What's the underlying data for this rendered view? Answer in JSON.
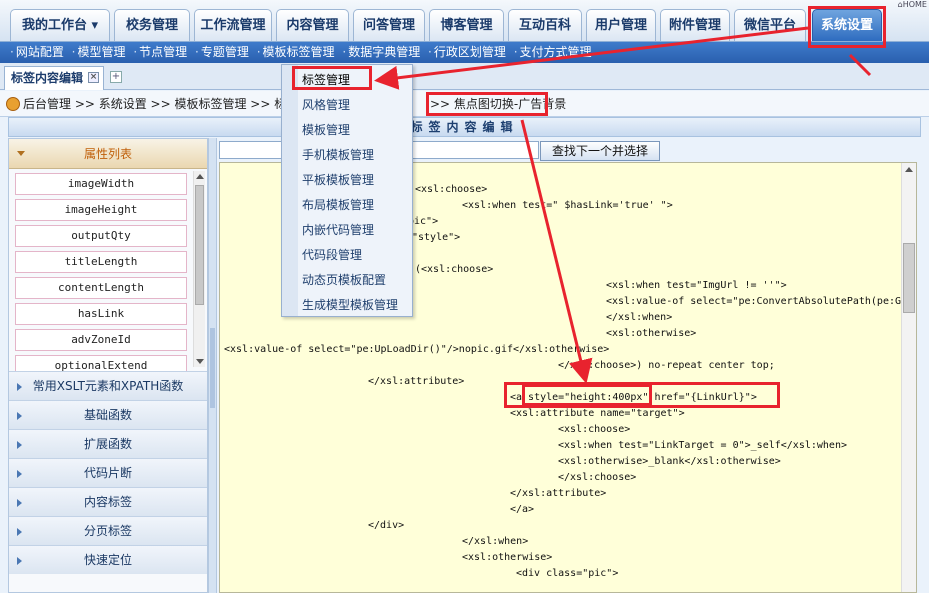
{
  "top_tabs": [
    {
      "label": "我的工作台 ▾"
    },
    {
      "label": "校务管理"
    },
    {
      "label": "工作流管理"
    },
    {
      "label": "内容管理"
    },
    {
      "label": "问答管理"
    },
    {
      "label": "博客管理"
    },
    {
      "label": "互动百科"
    },
    {
      "label": "用户管理"
    },
    {
      "label": "附件管理"
    },
    {
      "label": "微信平台"
    },
    {
      "label": "系统设置"
    }
  ],
  "home_link": "HOME",
  "sub_menu": [
    "网站配置",
    "模型管理",
    "节点管理",
    "专题管理",
    "模板标签管理",
    "数据字典管理",
    "行政区划管理",
    "支付方式管理"
  ],
  "doc_tab": {
    "label": "标签内容编辑",
    "close": "×",
    "add": "+"
  },
  "breadcrumb": {
    "path": "后台管理 >> 系统设置 >> 模板标签管理 >> 标签",
    "last": ">> 焦点图切换-广告背景"
  },
  "content_header": "标签内容编辑",
  "left_panel": {
    "attr_header": "属性列表",
    "attributes": [
      "imageWidth",
      "imageHeight",
      "outputQty",
      "titleLength",
      "contentLength",
      "hasLink",
      "advZoneId",
      "optionalExtend"
    ],
    "sections": [
      "常用XSLT元素和XPATH函数",
      "基础函数",
      "扩展函数",
      "代码片断",
      "内容标签",
      "分页标签",
      "快速定位"
    ]
  },
  "search": {
    "button_label": "查找下一个并选择"
  },
  "dropdown_menu": [
    "标签管理",
    "风格管理",
    "模板管理",
    "手机模板管理",
    "平板模板管理",
    "布局模板管理",
    "内嵌代码管理",
    "代码段管理",
    "动态页模板配置",
    "生成模型模板管理"
  ],
  "code_lines": [
    "<xsl:choose>",
    "<xsl:when test=\" $hasLink='true' \">",
    "pic\">",
    "\"style\">",
    "(<xsl:choose>",
    "<xsl:when test=\"ImgUrl != ''\">",
    "<xsl:value-of select=\"pe:ConvertAbsolutePath(pe:G",
    "</xsl:when>",
    "<xsl:otherwise>",
    "<xsl:value-of select=\"pe:UpLoadDir()\"/>nopic.gif</xsl:otherwise>",
    "</xsl:choose>) no-repeat center top;",
    "</xsl:attribute>",
    "<a style=\"height:400px\" href=\"{LinkUrl}\">",
    "<xsl:attribute name=\"target\">",
    "<xsl:choose>",
    "<xsl:when test=\"LinkTarget = 0\">_self</xsl:when>",
    "<xsl:otherwise>_blank</xsl:otherwise>",
    "</xsl:choose>",
    "</xsl:attribute>",
    "</a>",
    "</div>",
    "</xsl:when>",
    "<xsl:otherwise>",
    "<div class=\"pic\">"
  ],
  "colors": {
    "annotation": "#e8232e",
    "active_tab": "#2e6cc0",
    "editor_bg": "#ffffd9"
  }
}
